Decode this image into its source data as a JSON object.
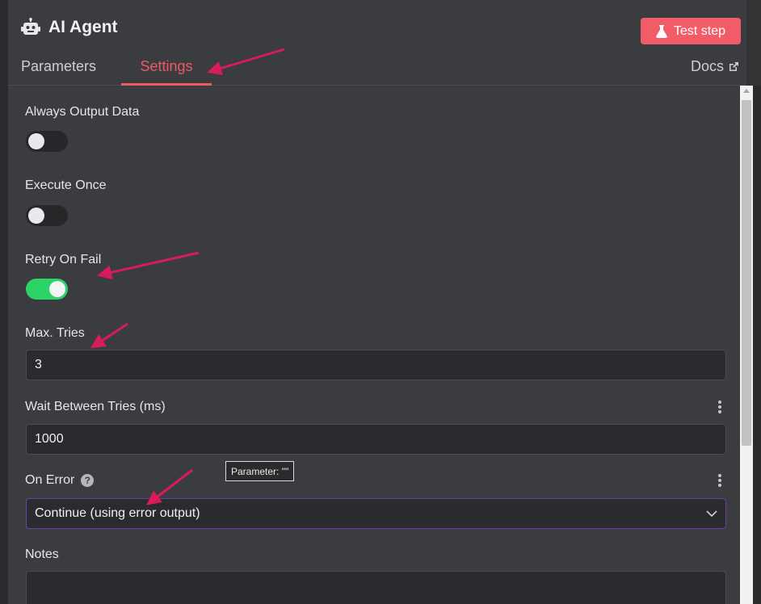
{
  "header": {
    "title": "AI Agent",
    "title_icon": "robot-icon",
    "test_button_label": "Test step",
    "test_button_icon": "flask-icon",
    "accent_color": "#f25c68"
  },
  "tabs": {
    "parameters": "Parameters",
    "settings": "Settings",
    "active": "Settings",
    "docs": "Docs"
  },
  "settings": {
    "always_output": {
      "label": "Always Output Data",
      "enabled": false
    },
    "execute_once": {
      "label": "Execute Once",
      "enabled": false
    },
    "retry_on_fail": {
      "label": "Retry On Fail",
      "enabled": true
    },
    "max_tries": {
      "label": "Max. Tries",
      "value": "3"
    },
    "wait_between": {
      "label": "Wait Between Tries (ms)",
      "value": "1000"
    },
    "on_error": {
      "label": "On Error",
      "value": "Continue (using error output)"
    },
    "notes": {
      "label": "Notes",
      "value": ""
    }
  },
  "tooltip": {
    "text": "Parameter: \"\""
  },
  "colors": {
    "toggle_on": "#2cd468",
    "annotation_arrow": "#d81b5a",
    "select_focus_border": "#6c3ea8"
  }
}
